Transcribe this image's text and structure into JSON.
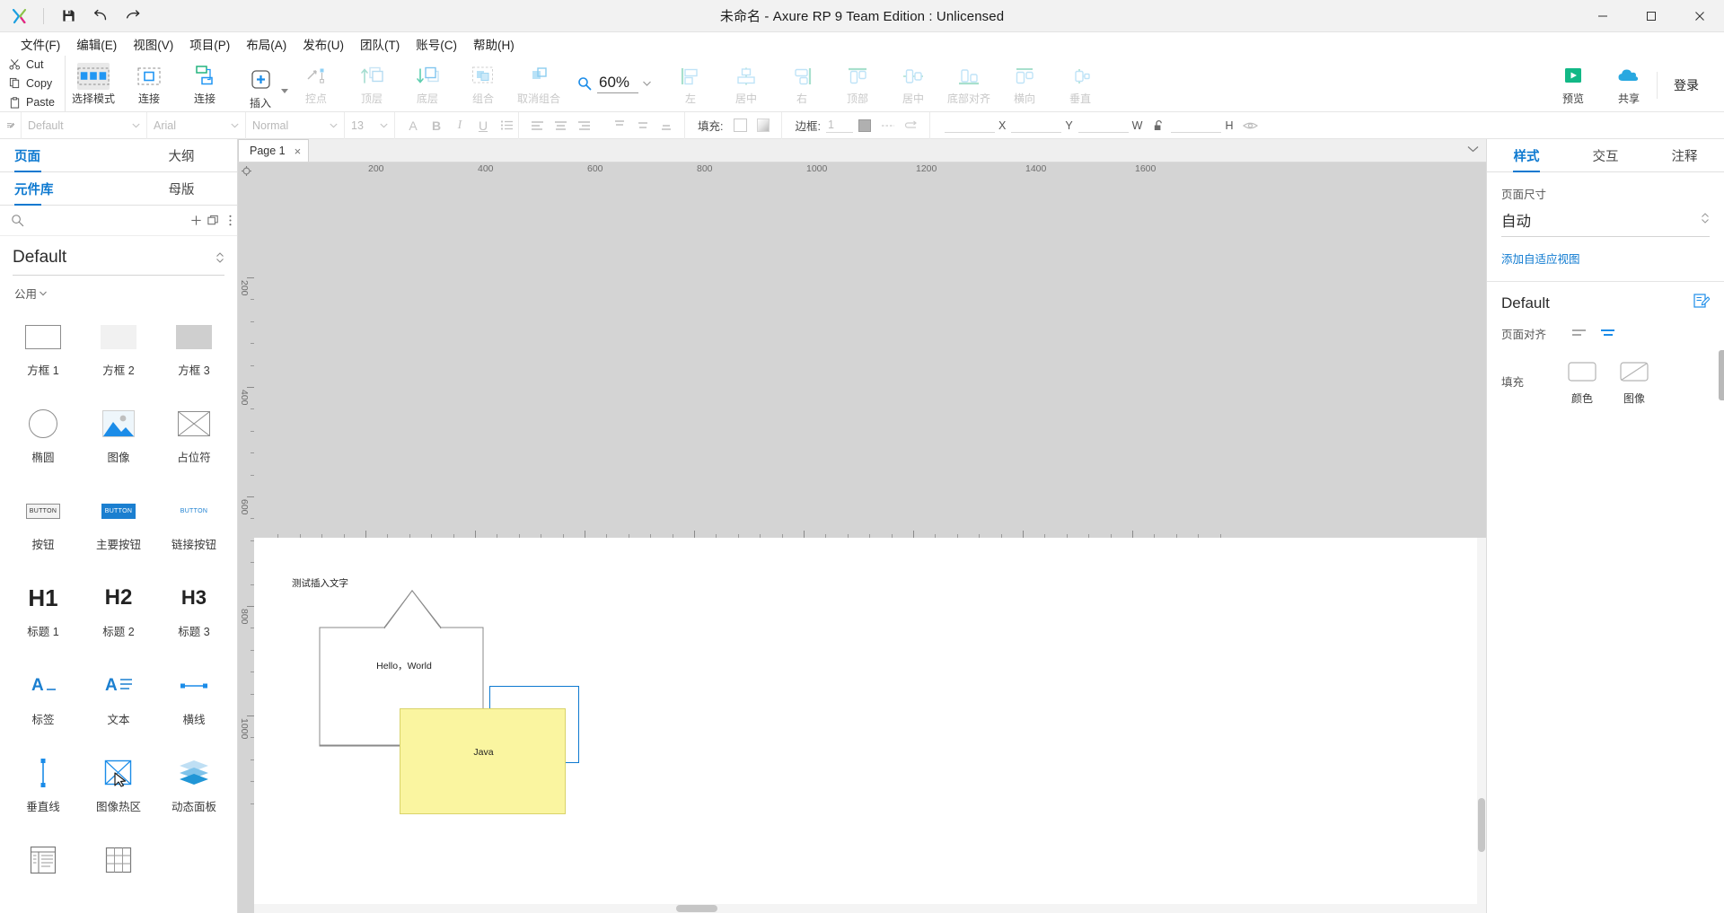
{
  "titlebar": {
    "title": "未命名 - Axure RP 9 Team Edition : Unlicensed",
    "icons": [
      {
        "name": "save-icon",
        "tip": "保存"
      },
      {
        "name": "undo-icon",
        "tip": "撤销"
      },
      {
        "name": "redo-icon",
        "tip": "重做"
      }
    ],
    "window_controls": [
      "minimize",
      "maximize",
      "close"
    ]
  },
  "menubar": {
    "items": [
      {
        "label": "文件(F)",
        "key": "F"
      },
      {
        "label": "编辑(E)",
        "key": "E"
      },
      {
        "label": "视图(V)",
        "key": "V"
      },
      {
        "label": "项目(P)",
        "key": "P"
      },
      {
        "label": "布局(A)",
        "key": "A"
      },
      {
        "label": "发布(U)",
        "key": "U"
      },
      {
        "label": "团队(T)",
        "key": "T"
      },
      {
        "label": "账号(C)",
        "key": "C"
      },
      {
        "label": "帮助(H)",
        "key": "H"
      }
    ]
  },
  "toolbar": {
    "clipboard": [
      {
        "label": "Cut",
        "icon": "scissors-icon"
      },
      {
        "label": "Copy",
        "icon": "copy-icon"
      },
      {
        "label": "Paste",
        "icon": "clipboard-icon"
      }
    ],
    "groups": [
      {
        "buttons": [
          {
            "label": "选择模式",
            "icon": "selection-mode-icon",
            "state": "active"
          },
          {
            "label": "连接",
            "icon": "connect-icon",
            "state": "normal"
          }
        ]
      },
      {
        "buttons": [
          {
            "label": "插入",
            "icon": "insert-plus-icon",
            "state": "normal",
            "has_dropdown": true
          }
        ]
      },
      {
        "buttons": [
          {
            "label": "控点",
            "icon": "handle-point-icon",
            "state": "disabled"
          }
        ]
      },
      {
        "buttons": [
          {
            "label": "顶层",
            "icon": "bring-to-front-icon",
            "state": "disabled"
          },
          {
            "label": "底层",
            "icon": "send-to-back-icon",
            "state": "disabled"
          }
        ]
      },
      {
        "buttons": [
          {
            "label": "组合",
            "icon": "group-icon",
            "state": "disabled"
          },
          {
            "label": "取消组合",
            "icon": "ungroup-icon",
            "state": "disabled"
          }
        ]
      }
    ],
    "zoom": {
      "icon": "magnifier-icon",
      "value": "60%"
    },
    "align_group": [
      {
        "label": "左",
        "icon": "align-left-icon",
        "state": "disabled"
      },
      {
        "label": "居中",
        "icon": "align-center-h-icon",
        "state": "disabled"
      },
      {
        "label": "右",
        "icon": "align-right-icon",
        "state": "disabled"
      }
    ],
    "align_group2": [
      {
        "label": "顶部",
        "icon": "align-top-icon",
        "state": "disabled"
      },
      {
        "label": "居中",
        "icon": "align-middle-v-icon",
        "state": "disabled"
      },
      {
        "label": "底部对齐",
        "icon": "align-bottom-icon",
        "state": "disabled"
      }
    ],
    "distribute_group": [
      {
        "label": "横向",
        "icon": "distribute-horizontal-icon",
        "state": "disabled"
      },
      {
        "label": "垂直",
        "icon": "distribute-vertical-icon",
        "state": "disabled"
      }
    ],
    "actions": [
      {
        "label": "预览",
        "icon": "preview-play-icon"
      },
      {
        "label": "共享",
        "icon": "cloud-share-icon"
      }
    ],
    "login_label": "登录"
  },
  "formatbar": {
    "style_icon": "style-brush-icon",
    "style_value": "Default",
    "font_family": "Arial",
    "font_weight": "Normal",
    "font_size": "13",
    "buttons": [
      {
        "name": "font-color-icon",
        "label": "A"
      },
      {
        "name": "bold-icon",
        "label": "B"
      },
      {
        "name": "italic-icon",
        "label": "I"
      },
      {
        "name": "underline-icon",
        "label": "U"
      },
      {
        "name": "bullet-list-icon",
        "label": "list"
      }
    ],
    "align_buttons": [
      "align-left-icon",
      "align-center-icon",
      "align-right-icon",
      "align-justify-icon"
    ],
    "valign_buttons": [
      "valign-top-icon",
      "valign-middle-icon",
      "valign-bottom-icon"
    ],
    "fill_label": "填充:",
    "border_label": "边框:",
    "border_width": "1",
    "coords": {
      "x_label": "X",
      "y_label": "Y",
      "w_label": "W",
      "h_label": "H",
      "lock_icon": "unlock-icon",
      "eye_icon": "eye-icon"
    }
  },
  "left_panel": {
    "top_tabs": [
      {
        "label": "页面",
        "active": true
      },
      {
        "label": "大纲",
        "active": false
      }
    ],
    "lib_tabs": [
      {
        "label": "元件库",
        "active": true
      },
      {
        "label": "母版",
        "active": false
      }
    ],
    "search_placeholder": "",
    "search_icon": "search-icon",
    "add_icon": "plus-icon",
    "duplicate_icon": "stack-icon",
    "more_icon": "more-vertical-icon",
    "library_name": "Default",
    "group_label": "公用",
    "widgets": [
      {
        "label": "方框 1",
        "icon": "box1-icon"
      },
      {
        "label": "方框 2",
        "icon": "box2-icon"
      },
      {
        "label": "方框 3",
        "icon": "box3-icon"
      },
      {
        "label": "椭圆",
        "icon": "ellipse-icon"
      },
      {
        "label": "图像",
        "icon": "image-icon"
      },
      {
        "label": "占位符",
        "icon": "placeholder-icon"
      },
      {
        "label": "按钮",
        "icon": "button-icon"
      },
      {
        "label": "主要按钮",
        "icon": "primary-button-icon"
      },
      {
        "label": "链接按钮",
        "icon": "link-button-icon"
      },
      {
        "label": "标题 1",
        "icon": "h1-icon",
        "glyph": "H1"
      },
      {
        "label": "标题 2",
        "icon": "h2-icon",
        "glyph": "H2"
      },
      {
        "label": "标题 3",
        "icon": "h3-icon",
        "glyph": "H3"
      },
      {
        "label": "标签",
        "icon": "label-icon"
      },
      {
        "label": "文本",
        "icon": "text-icon"
      },
      {
        "label": "横线",
        "icon": "horizontal-line-icon"
      },
      {
        "label": "垂直线",
        "icon": "vertical-line-icon"
      },
      {
        "label": "图像热区",
        "icon": "hotspot-icon"
      },
      {
        "label": "动态面板",
        "icon": "dynamic-panel-icon"
      },
      {
        "label": "",
        "icon": "inline-frame-icon"
      },
      {
        "label": "",
        "icon": "repeater-icon"
      }
    ]
  },
  "center": {
    "page_tab": {
      "label": "Page 1",
      "close": "×"
    },
    "tabs_caret": "chevron-down-icon",
    "ruler": {
      "h_labels": [
        "200",
        "400",
        "600",
        "800",
        "1000",
        "1200",
        "1400",
        "1600"
      ],
      "v_labels": [
        "200",
        "400",
        "600",
        "800",
        "1000"
      ]
    },
    "canvas_objects": [
      {
        "name": "home-shape",
        "type": "house-outline",
        "text": "Hello，World"
      },
      {
        "name": "text-label",
        "type": "text",
        "text": "测试插入文字"
      },
      {
        "name": "yellow-rect",
        "type": "rect",
        "text": "Java",
        "fill": "#FAF5A0",
        "border": "#D9D36A"
      },
      {
        "name": "selected-rect",
        "type": "rect-selected",
        "text": "",
        "border": "#0d79d0"
      }
    ]
  },
  "right_panel": {
    "tabs": [
      {
        "label": "样式",
        "active": true
      },
      {
        "label": "交互",
        "active": false
      },
      {
        "label": "注释",
        "active": false
      }
    ],
    "page_size_label": "页面尺寸",
    "page_size_value": "自动",
    "adaptive_link": "添加自适应视图",
    "style_name": "Default",
    "style_edit_icon": "edit-style-icon",
    "page_align_label": "页面对齐",
    "align_options": [
      {
        "icon": "page-align-left-icon",
        "active": false
      },
      {
        "icon": "page-align-center-icon",
        "active": true
      }
    ],
    "fill_label": "填充",
    "fill_options": [
      {
        "label": "颜色",
        "icon": "fill-color-icon"
      },
      {
        "label": "图像",
        "icon": "fill-image-icon"
      }
    ]
  },
  "colors": {
    "accent": "#0d79d0",
    "yellow_fill": "#FAF5A0",
    "yellow_border": "#D9D36A",
    "selection": "#0d79d0",
    "ruler_bg": "#d4d4d4"
  }
}
